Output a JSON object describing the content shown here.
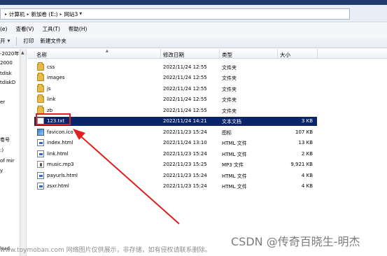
{
  "address": {
    "crumbs": [
      "计算机",
      "新加卷 (E:)",
      "网站3"
    ]
  },
  "menu": [
    "查看(V)",
    "工具(T)",
    "帮助(H)"
  ],
  "menu_prefix": "(e)",
  "toolbar": {
    "open": "开",
    "print": "打印",
    "new_folder": "新建文件夹"
  },
  "nav": [
    "-2020年",
    "2000",
    "tdisk",
    "tdiskD",
    "er",
    "卷号",
    ":)",
    "of mir",
    "y",
    "load"
  ],
  "columns": {
    "name": "名称",
    "date": "修改日期",
    "type": "类型",
    "size": "大小"
  },
  "files": [
    {
      "name": "css",
      "date": "2022/11/24 12:55",
      "type": "文件夹",
      "size": "",
      "icon": "folder-icon"
    },
    {
      "name": "images",
      "date": "2022/11/24 12:55",
      "type": "文件夹",
      "size": "",
      "icon": "folder-icon"
    },
    {
      "name": "js",
      "date": "2022/11/24 12:55",
      "type": "文件夹",
      "size": "",
      "icon": "folder-icon"
    },
    {
      "name": "link",
      "date": "2022/11/24 12:55",
      "type": "文件夹",
      "size": "",
      "icon": "folder-icon"
    },
    {
      "name": "zb",
      "date": "2022/11/24 12:55",
      "type": "文件夹",
      "size": "",
      "icon": "folder-icon"
    },
    {
      "name": "123.txt",
      "date": "2022/11/24 14:21",
      "type": "文本文档",
      "size": "3 KB",
      "icon": "text-file-icon"
    },
    {
      "name": "favicon.ico",
      "date": "2022/11/23 15:24",
      "type": "图标",
      "size": "107 KB",
      "icon": "image-icon"
    },
    {
      "name": "index.html",
      "date": "2022/11/24 13:10",
      "type": "HTML 文件",
      "size": "13 KB",
      "icon": "html-file-icon"
    },
    {
      "name": "link.html",
      "date": "2022/11/23 15:24",
      "type": "HTML 文件",
      "size": "2 KB",
      "icon": "html-file-icon"
    },
    {
      "name": "music.mp3",
      "date": "2022/11/23 15:25",
      "type": "MP3 文件",
      "size": "9,921 KB",
      "icon": "audio-file-icon"
    },
    {
      "name": "payurls.html",
      "date": "2022/11/23 15:24",
      "type": "HTML 文件",
      "size": "4 KB",
      "icon": "html-file-icon"
    },
    {
      "name": "zsxr.html",
      "date": "2022/11/23 15:24",
      "type": "HTML 文件",
      "size": "4 KB",
      "icon": "html-file-icon"
    }
  ],
  "selected_index": 5,
  "watermark": {
    "line1": "www.toymoban.com 网络图片仅供展示，非存储，如有侵权请联系删除。",
    "line2": "CSDN @传奇百晓生-明杰"
  },
  "colors": {
    "selection": "#0a246a",
    "annotation": "#e02020"
  }
}
